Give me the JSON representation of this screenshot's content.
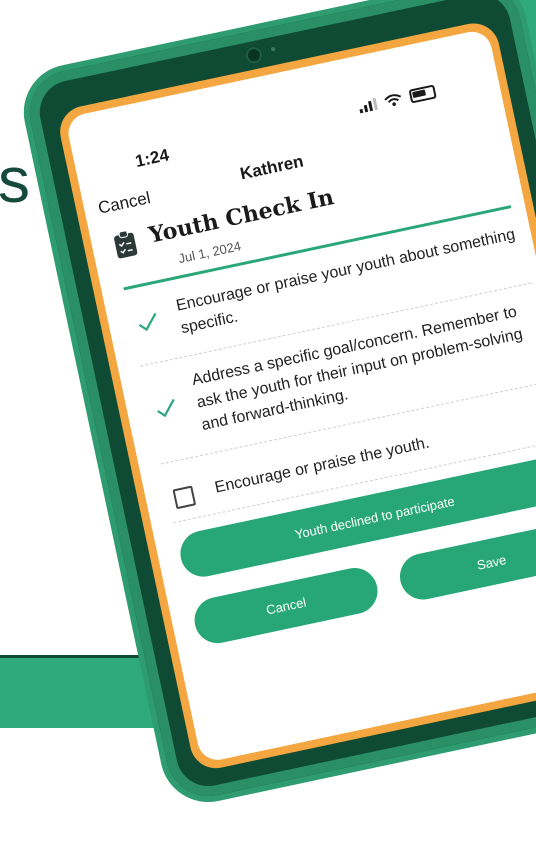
{
  "background": {
    "partial_heading": "s"
  },
  "status_bar": {
    "time": "1:24"
  },
  "nav": {
    "cancel_label": "Cancel",
    "title": "Kathren"
  },
  "check_in": {
    "title": "Youth Check In",
    "date": "Jul 1, 2024",
    "icon": "clipboard-icon"
  },
  "checklist": [
    {
      "text": "Encourage or praise your youth about something specific.",
      "checked": true
    },
    {
      "text": "Address a specific goal/concern. Remember to ask the youth for their input on problem-solving and forward-thinking.",
      "checked": true
    },
    {
      "text": "Encourage or praise the youth.",
      "checked": false
    }
  ],
  "buttons": {
    "declined_label": "Youth declined to participate",
    "cancel_label": "Cancel",
    "save_label": "Save"
  },
  "colors": {
    "accent": "#27a778",
    "frame": "#0f4a34",
    "bezel": "#f4a640"
  }
}
